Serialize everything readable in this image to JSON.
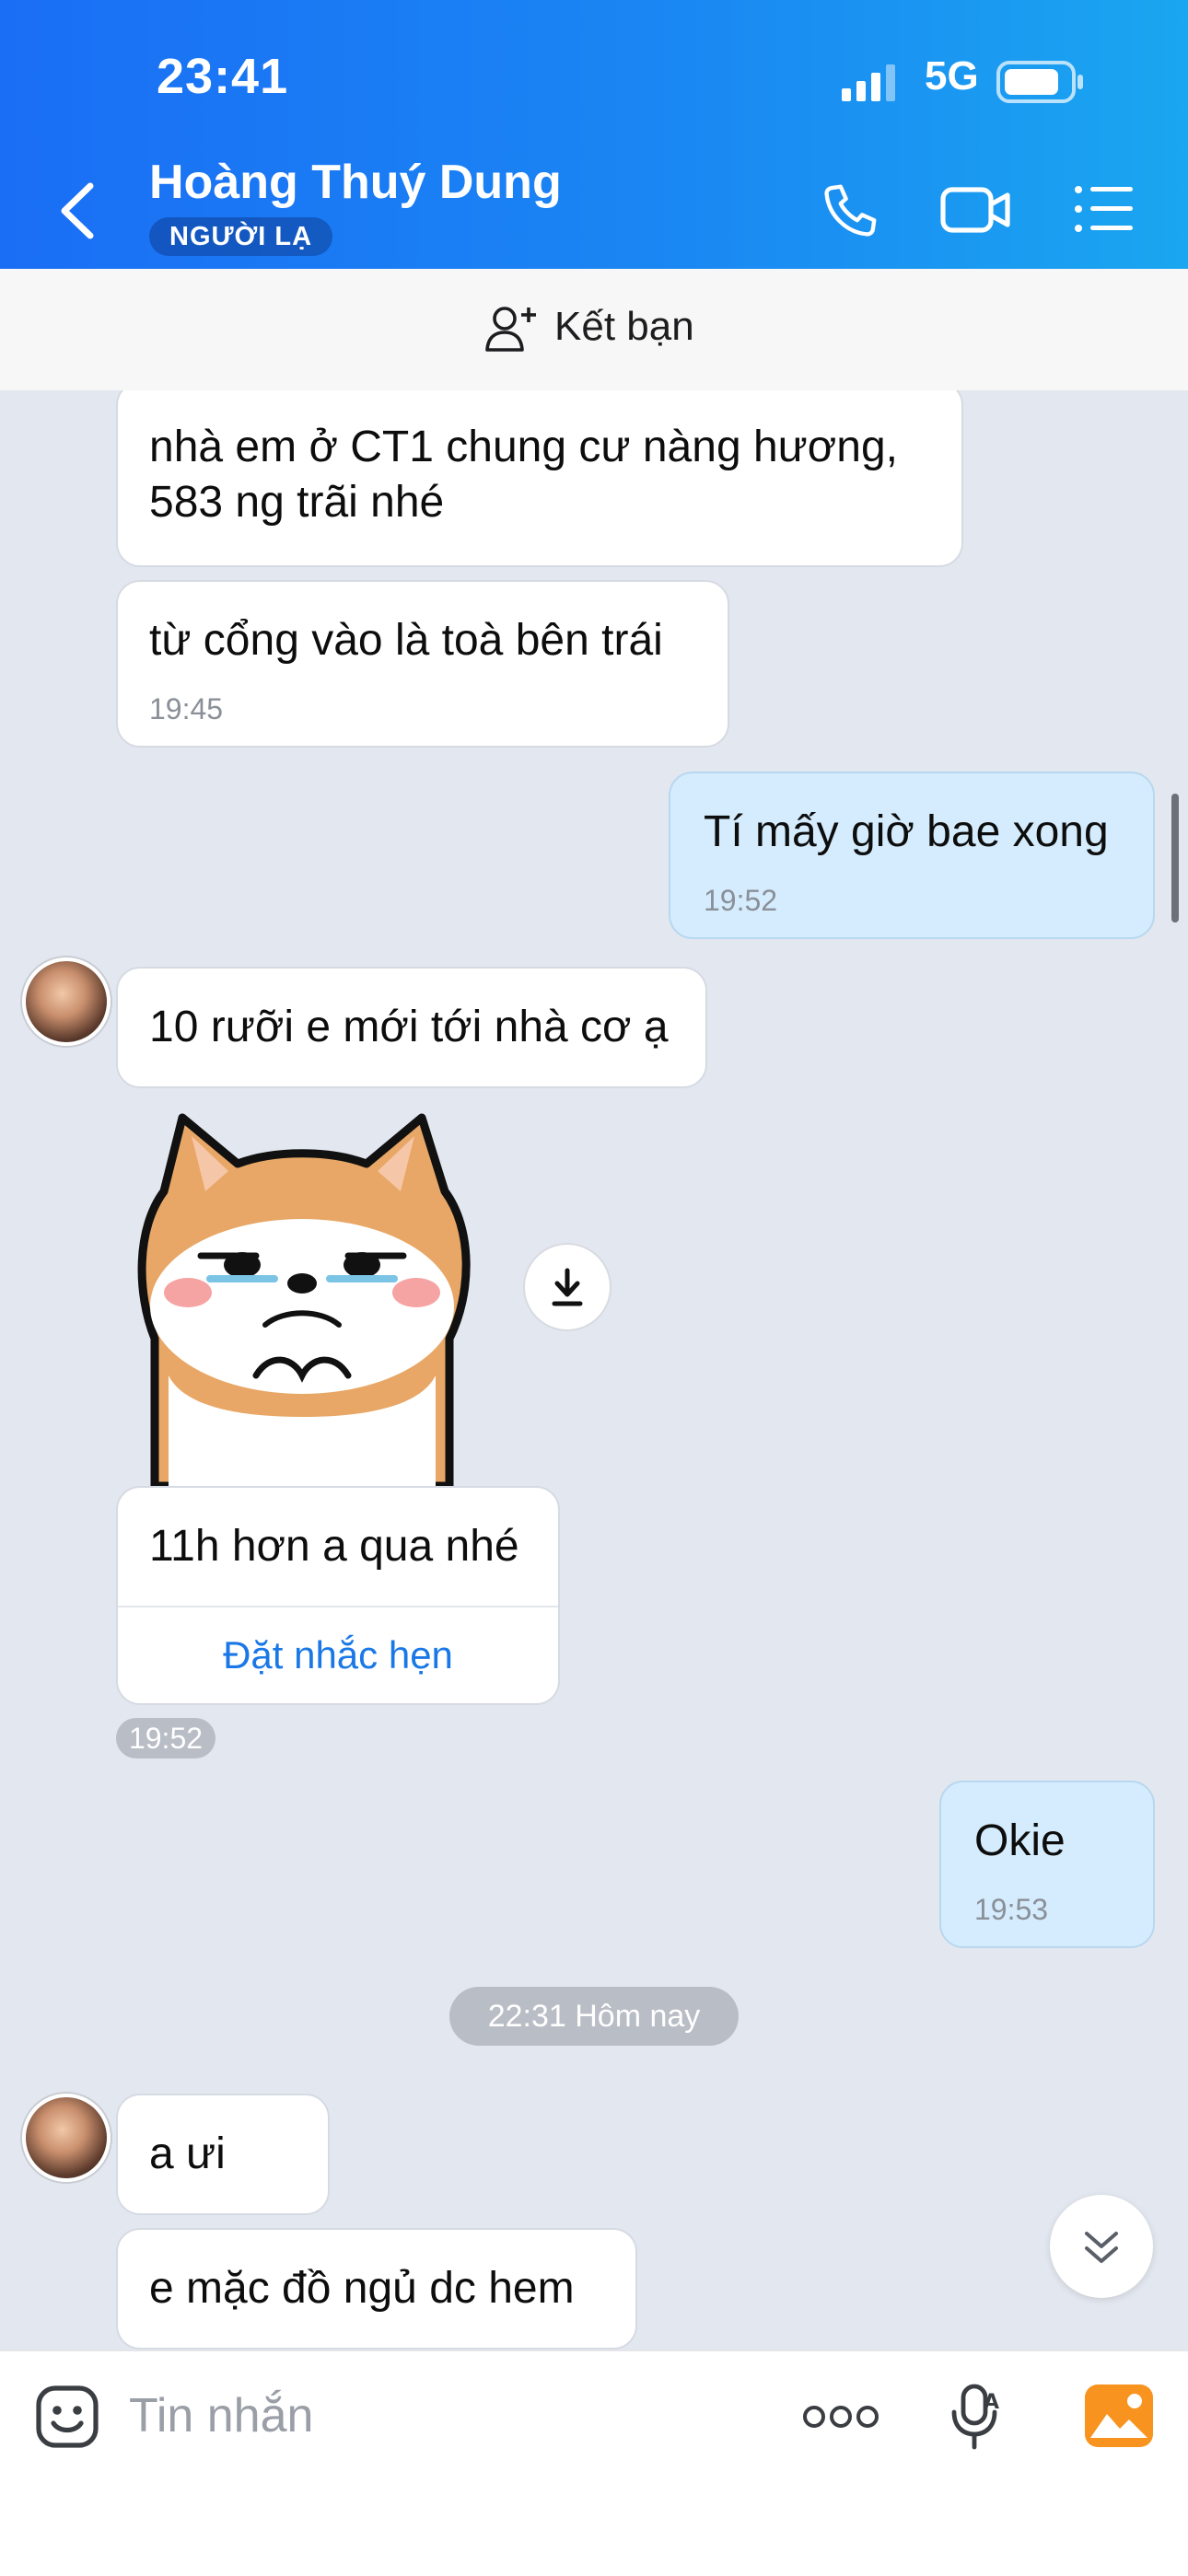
{
  "status_bar": {
    "time": "23:41",
    "network": "5G"
  },
  "header": {
    "contact_name": "Hoàng Thuý Dung",
    "badge": "NGƯỜI LẠ"
  },
  "friend_bar": {
    "label": "Kết bạn"
  },
  "messages": [
    {
      "dir": "in",
      "lines": [
        "nhà em ở CT1 chung cư nàng hương,",
        "583 ng trãi nhé"
      ]
    },
    {
      "dir": "in",
      "lines": [
        "từ cổng vào là toà bên trái"
      ],
      "time": "19:45"
    },
    {
      "dir": "out",
      "lines": [
        "Tí mấy giờ bae xong"
      ],
      "time": "19:52"
    },
    {
      "dir": "in",
      "lines": [
        "10 rưỡi e mới tới nhà cơ ạ"
      ]
    },
    {
      "dir": "in",
      "type": "sticker"
    },
    {
      "dir": "in",
      "lines": [
        "11h hơn a qua nhé"
      ],
      "action": "Đặt nhắc hẹn",
      "time": "19:52"
    },
    {
      "dir": "out",
      "lines": [
        "Okie"
      ],
      "time": "19:53"
    },
    {
      "type": "separator",
      "text": "22:31 Hôm nay"
    },
    {
      "dir": "in",
      "lines": [
        "a ưi"
      ]
    },
    {
      "dir": "in",
      "lines": [
        "e mặc đồ ngủ dc hem"
      ]
    }
  ],
  "input_bar": {
    "placeholder": "Tin nhắn"
  },
  "colors": {
    "header_start": "#1a6ef5",
    "header_end": "#1aa6f0",
    "chat_bg": "#e3e7ef",
    "outgoing_bubble": "#d4ecfd",
    "link_blue": "#1a78e6",
    "gallery_orange": "#f7931e"
  },
  "icons": [
    "signal-icon",
    "battery-icon",
    "back-chevron-icon",
    "phone-icon",
    "video-call-icon",
    "menu-list-icon",
    "add-friend-icon",
    "download-icon",
    "scroll-down-icon",
    "emoji-icon",
    "more-dots-icon",
    "voice-input-icon",
    "gallery-icon"
  ]
}
